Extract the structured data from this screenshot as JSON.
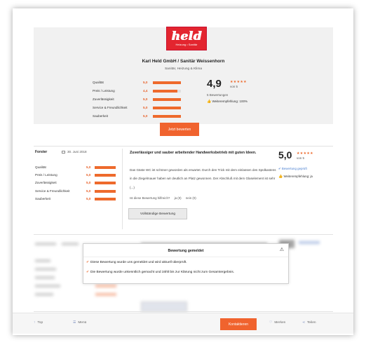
{
  "colors": {
    "accent": "#ee6a2c",
    "logo_red": "#e3252f",
    "link_blue": "#4a7fd0"
  },
  "logo": {
    "word": "held",
    "sub": "Heizung • Sanitär"
  },
  "company": {
    "name": "Karl Held GmbH / Sanitär Weissenhorn",
    "subtitle": "Sanitär, Heizung & Klima"
  },
  "summary": {
    "criteria": [
      {
        "label": "Qualität",
        "value": "5,0",
        "fraction": 1.0
      },
      {
        "label": "Preis / Leistung",
        "value": "4,4",
        "fraction": 0.88
      },
      {
        "label": "Zuverlässigkeit",
        "value": "5,0",
        "fraction": 1.0
      },
      {
        "label": "Service & Freundlichkeit",
        "value": "5,0",
        "fraction": 1.0
      },
      {
        "label": "Sauberkeit",
        "value": "5,0",
        "fraction": 1.0
      }
    ],
    "score": "4,9",
    "stars": "★★★★★",
    "of": "von 5",
    "count": "5 Bewertungen",
    "recommendation": "Weiterempfehlung: 100%"
  },
  "write_review_label": "Jetzt bewerten",
  "review": {
    "author": "Forster",
    "date": "30. Juni 2018",
    "criteria": [
      {
        "label": "Qualität",
        "value": "5,0",
        "fraction": 1.0
      },
      {
        "label": "Preis / Leistung",
        "value": "5,0",
        "fraction": 1.0
      },
      {
        "label": "Zuverlässigkeit",
        "value": "5,0",
        "fraction": 1.0
      },
      {
        "label": "Service & Freundlichkeit",
        "value": "5,0",
        "fraction": 1.0
      },
      {
        "label": "Sauberkeit",
        "value": "5,0",
        "fraction": 1.0
      }
    ],
    "title": "Zuverlässiger und sauber arbeitender Handwerksbetrieb mit guten Ideen.",
    "text": "Das Gäste WC ist schöner geworden als erwartet. Durch den Trick mit dem einlassen des Spülkastens in die Ziegelmauer haben wir deutlich an Platz gewonnen. Der Abschluß mit dem Glaselement ist sehr (...)",
    "helpful_question": "Ist diese Bewertung hilfreich?",
    "helpful_yes": "ja (0)",
    "helpful_no": "nein (0)",
    "full_button": "Vollständige Bewertung",
    "score": "5,0",
    "stars": "★★★★★",
    "of": "von 5",
    "verified": "Bewertung geprüft",
    "recommendation": "Weiterempfehlung: ja"
  },
  "notice": {
    "title": "Bewertung gemeldet",
    "messages": [
      "Diese Bewertung wurde uns gemeldet und wird aktuell überprüft.",
      "Die Bewertung wurde unkenntlich gemacht und zählt bis zur Klärung nicht zum Gesamtergebnis."
    ]
  },
  "bottom_bar": {
    "top": "Top",
    "menu": "Menü",
    "contact": "Kontaktieren",
    "remember": "Merken",
    "share": "Teilen"
  }
}
